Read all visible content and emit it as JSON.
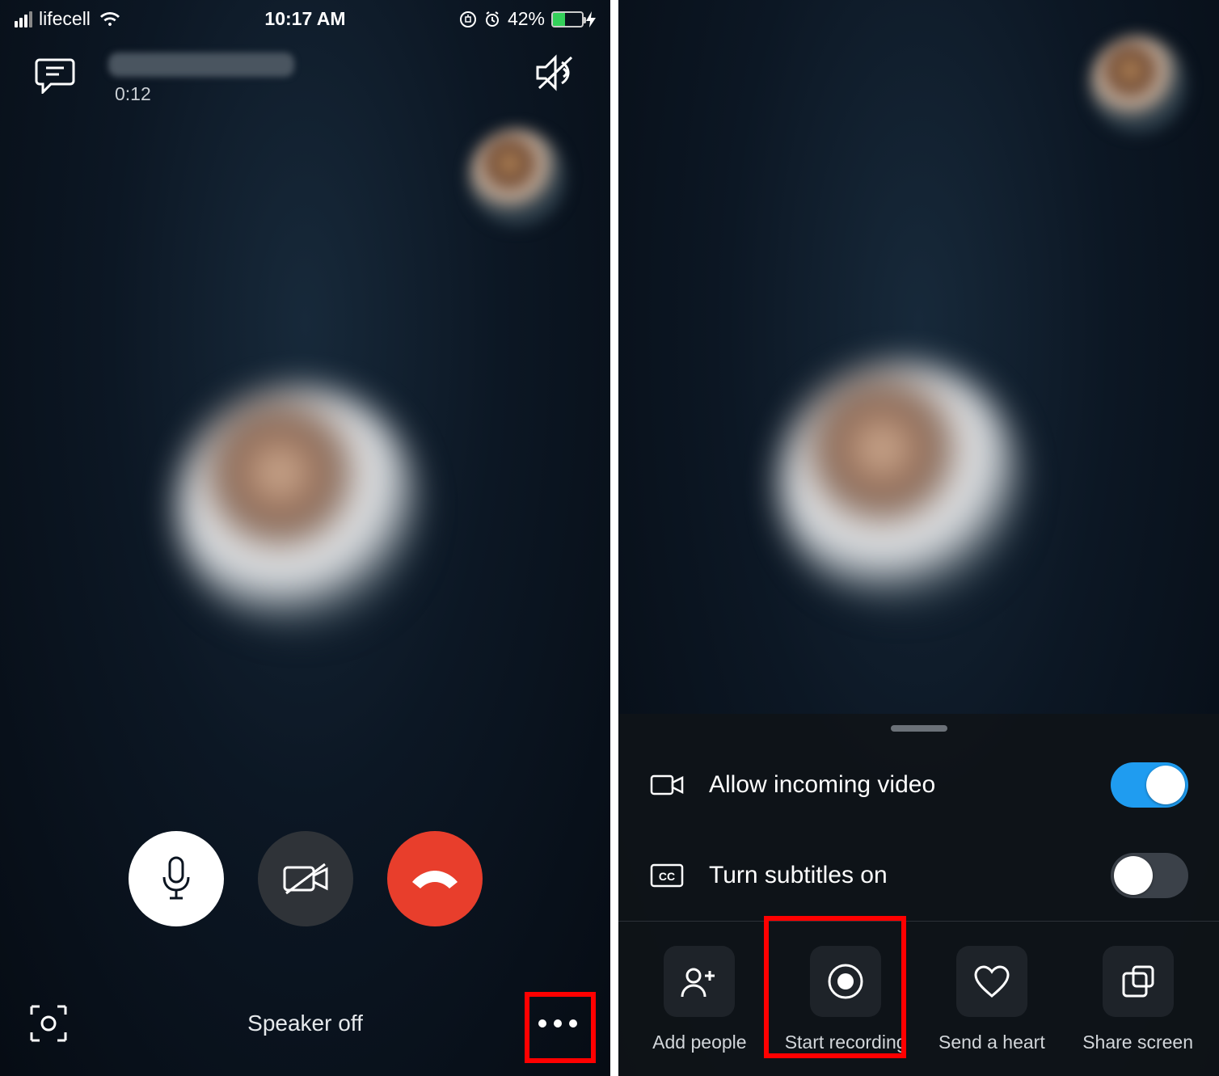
{
  "status_bar": {
    "carrier": "lifecell",
    "time": "10:17 AM",
    "battery_pct": "42%"
  },
  "call": {
    "duration": "0:12",
    "speaker_status": "Speaker off"
  },
  "panel": {
    "allow_incoming_video": {
      "label": "Allow incoming video",
      "state": "on"
    },
    "turn_subtitles_on": {
      "label": "Turn subtitles on",
      "state": "off"
    },
    "actions": {
      "add_people": "Add people",
      "start_recording": "Start recording",
      "send_heart": "Send a heart",
      "share_screen": "Share screen"
    }
  }
}
